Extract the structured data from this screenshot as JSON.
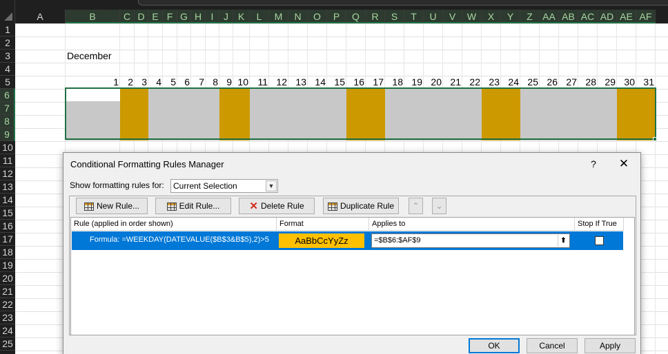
{
  "sheet": {
    "columns": [
      "A",
      "B",
      "C",
      "D",
      "E",
      "F",
      "G",
      "H",
      "I",
      "J",
      "K",
      "L",
      "M",
      "N",
      "O",
      "P",
      "Q",
      "R",
      "S",
      "T",
      "U",
      "V",
      "W",
      "X",
      "Y",
      "Z",
      "AA",
      "AB",
      "AC",
      "AD",
      "AE",
      "AF"
    ],
    "rows": [
      "1",
      "2",
      "3",
      "4",
      "5",
      "6",
      "7",
      "8",
      "9",
      "10",
      "11",
      "12",
      "13",
      "14",
      "15",
      "16",
      "17",
      "18",
      "19",
      "20",
      "21",
      "22",
      "23",
      "24",
      "25"
    ],
    "month": "December",
    "days": [
      "1",
      "2",
      "3",
      "4",
      "5",
      "6",
      "7",
      "8",
      "9",
      "10",
      "11",
      "12",
      "13",
      "14",
      "15",
      "16",
      "17",
      "18",
      "19",
      "20",
      "21",
      "22",
      "23",
      "24",
      "25",
      "26",
      "27",
      "28",
      "29",
      "30",
      "31"
    ],
    "weekend_fill": "#cc9900",
    "weekday_fill": "#c8c8c8"
  },
  "dialog": {
    "title": "Conditional Formatting Rules Manager",
    "help": "?",
    "close": "✕",
    "show_label": "Show formatting rules for:",
    "show_value": "Current Selection",
    "toolbar": {
      "new_rule": "New Rule...",
      "edit_rule": "Edit Rule...",
      "delete_rule": "Delete Rule",
      "duplicate_rule": "Duplicate Rule",
      "move_up": "⌃",
      "move_down": "⌄"
    },
    "columns": {
      "rule": "Rule (applied in order shown)",
      "format": "Format",
      "applies_to": "Applies to",
      "stop_if_true": "Stop If True"
    },
    "rules": [
      {
        "formula": "Formula: =WEEKDAY(DATEVALUE($B$3&B$5),2)>5",
        "format_preview": "AaBbCcYyZz",
        "applies_to": "=$B$6:$AF$9",
        "stop_if_true": false
      }
    ],
    "buttons": {
      "ok": "OK",
      "cancel": "Cancel",
      "apply": "Apply"
    },
    "accent": "#0078d7",
    "format_fill": "#ffc000"
  }
}
